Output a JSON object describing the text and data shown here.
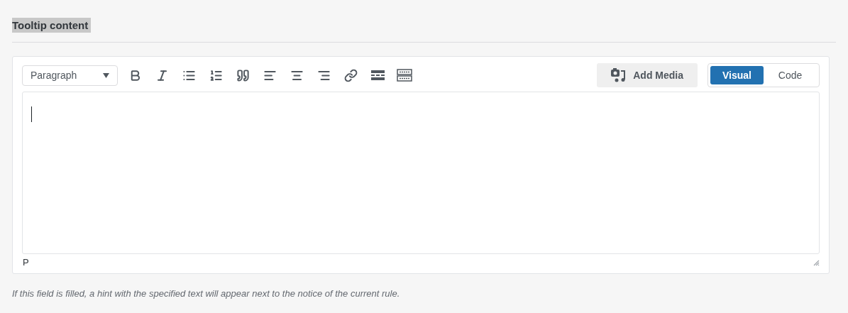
{
  "title": {
    "text": "Tooltip content",
    "highlighted": true
  },
  "toolbar": {
    "format_select": {
      "value": "Paragraph"
    },
    "add_media": {
      "label": "Add Media"
    },
    "tabs": [
      {
        "label": "Visual",
        "selected": true
      },
      {
        "label": "Code",
        "selected": false
      }
    ]
  },
  "status_bar": {
    "path": "P"
  },
  "hint": "If this field is filled, a hint with the specified text will appear next to the notice of the current rule."
}
